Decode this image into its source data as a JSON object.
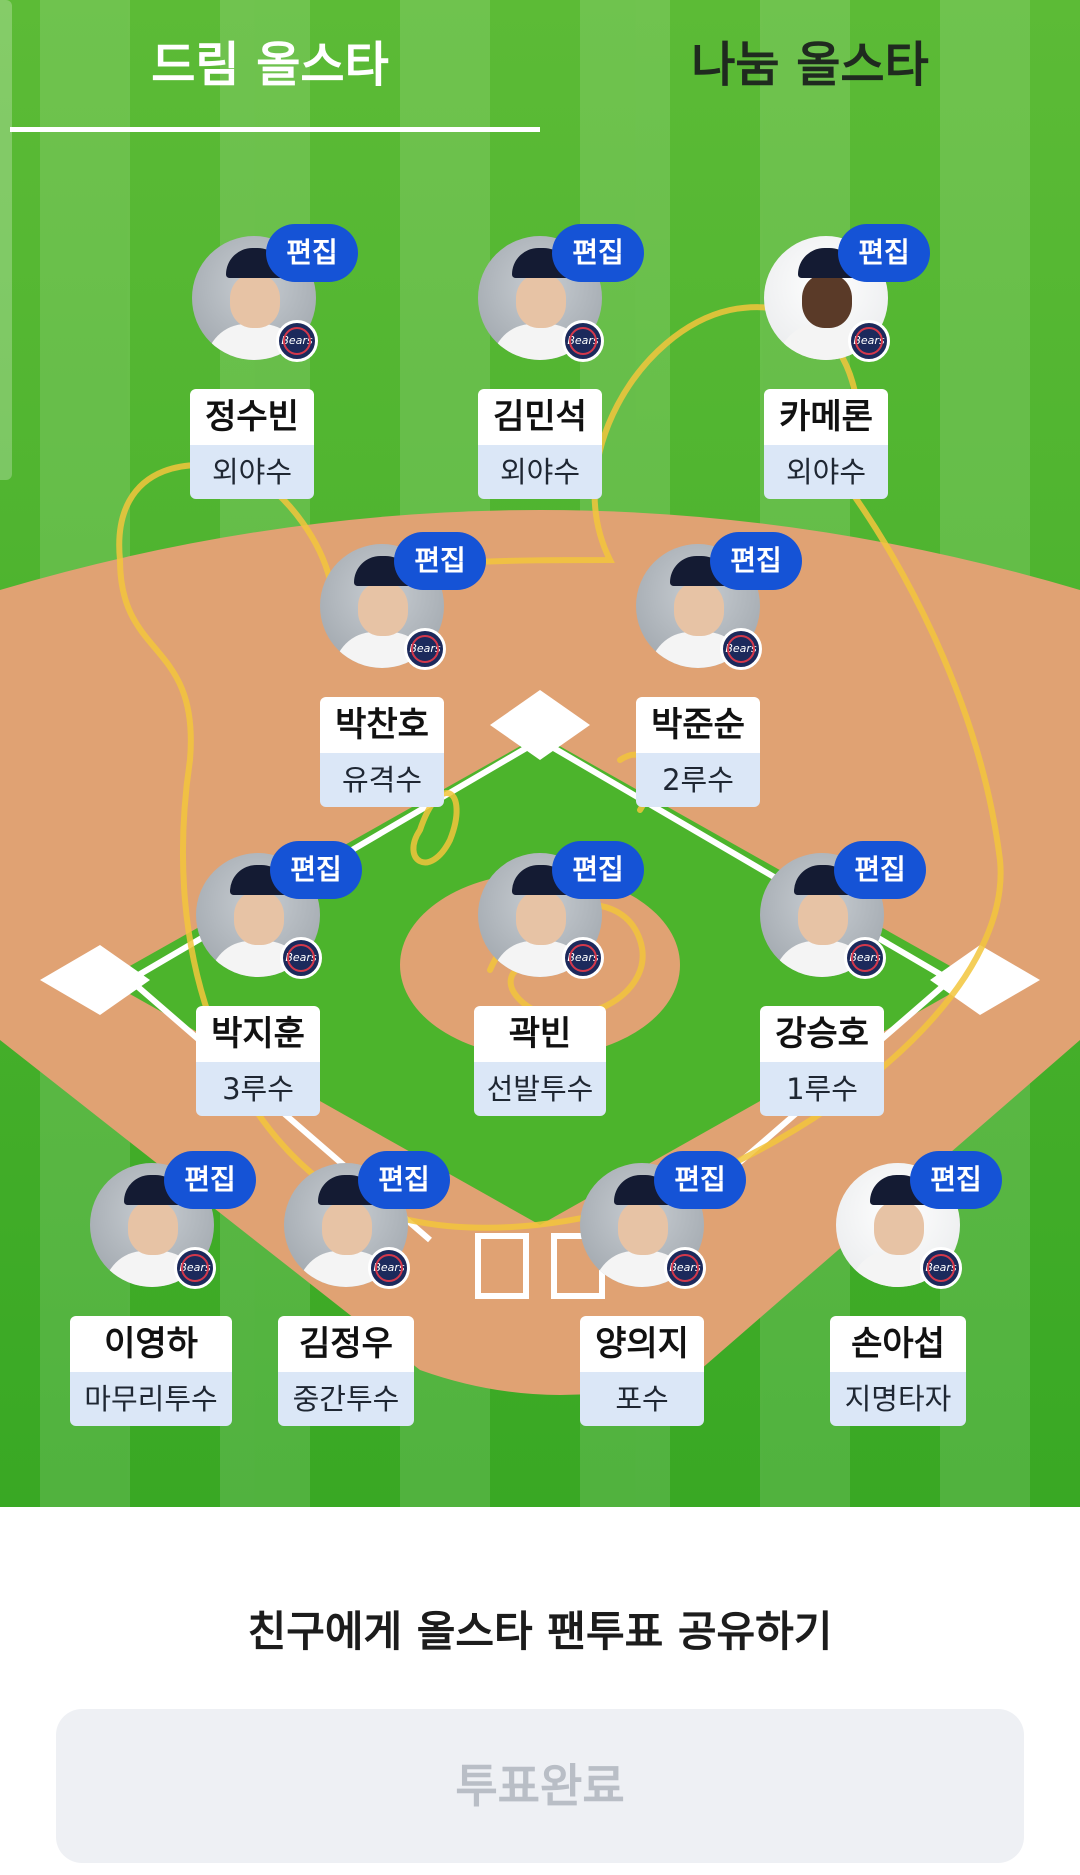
{
  "tabs": [
    {
      "label": "드림 올스타",
      "active": true
    },
    {
      "label": "나눔 올스타",
      "active": false
    }
  ],
  "edit_label": "편집",
  "team_logo_text": "Bears",
  "players": [
    {
      "name": "정수빈",
      "position": "외야수"
    },
    {
      "name": "김민석",
      "position": "외야수"
    },
    {
      "name": "카메론",
      "position": "외야수"
    },
    {
      "name": "박찬호",
      "position": "유격수"
    },
    {
      "name": "박준순",
      "position": "2루수"
    },
    {
      "name": "박지훈",
      "position": "3루수"
    },
    {
      "name": "곽빈",
      "position": "선발투수"
    },
    {
      "name": "강승호",
      "position": "1루수"
    },
    {
      "name": "이영하",
      "position": "마무리투수"
    },
    {
      "name": "김정우",
      "position": "중간투수"
    },
    {
      "name": "양의지",
      "position": "포수"
    },
    {
      "name": "손아섭",
      "position": "지명타자"
    }
  ],
  "share_title": "친구에게 올스타 팬투표 공유하기",
  "vote_button_label": "투표완료",
  "colors": {
    "grass": "#4cb42c",
    "infield_dirt": "#e0a273",
    "edit_badge": "#1553d6",
    "position_bg": "#dbe7f7",
    "doodle": "#f2c53c"
  }
}
